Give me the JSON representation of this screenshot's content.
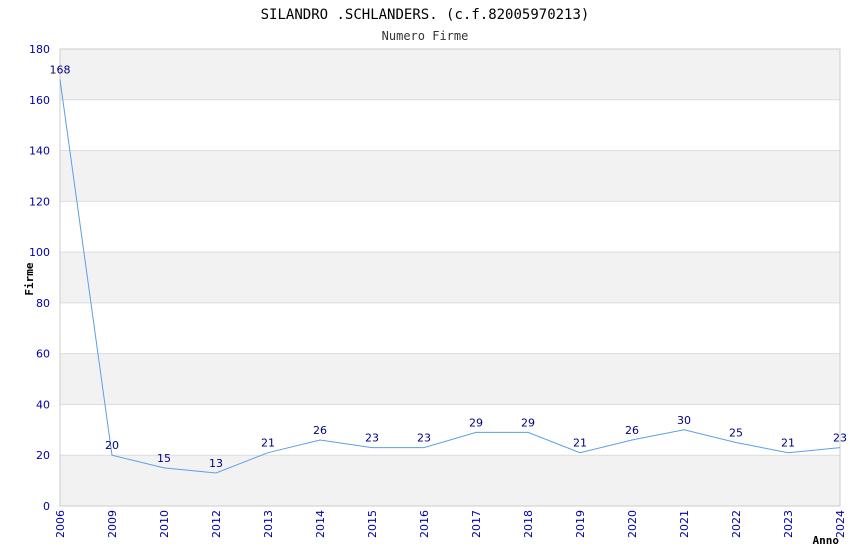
{
  "chart_data": {
    "type": "line",
    "title": "SILANDRO .SCHLANDERS. (c.f.82005970213)",
    "subtitle": "Numero Firme",
    "xlabel": "Anno",
    "ylabel": "Firme",
    "categories": [
      "2006",
      "2009",
      "2010",
      "2012",
      "2013",
      "2014",
      "2015",
      "2016",
      "2017",
      "2018",
      "2019",
      "2020",
      "2021",
      "2022",
      "2023",
      "2024"
    ],
    "values": [
      168,
      20,
      15,
      13,
      21,
      26,
      23,
      23,
      29,
      29,
      21,
      26,
      30,
      25,
      21,
      23
    ],
    "ylim": [
      0,
      180
    ],
    "yticks": [
      0,
      20,
      40,
      60,
      80,
      100,
      120,
      140,
      160,
      180
    ],
    "grid": true,
    "colors": {
      "line": "#5aa0e6",
      "band": "#f2f2f2",
      "grid": "#dddddd",
      "tick_label": "#0000aa",
      "data_label": "#000080"
    }
  }
}
